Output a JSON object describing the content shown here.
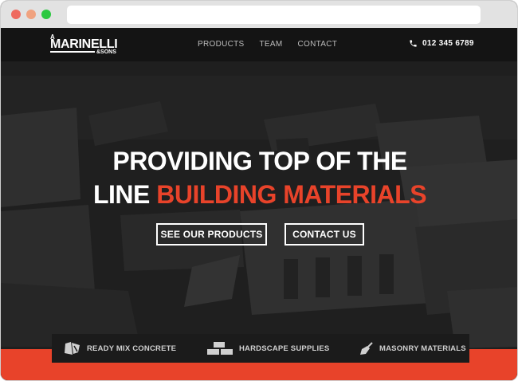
{
  "logo": {
    "prefix": "A",
    "name": "MARINELLI",
    "suffix": "&SONS"
  },
  "nav": {
    "items": [
      {
        "label": "PRODUCTS"
      },
      {
        "label": "TEAM"
      },
      {
        "label": "CONTACT"
      }
    ]
  },
  "phone": {
    "number": "012 345 6789",
    "icon": "phone-icon"
  },
  "hero": {
    "headline_line1": "PROVIDING TOP OF THE",
    "headline_line2_prefix": "LINE ",
    "headline_line2_accent": "BUILDING MATERIALS",
    "cta_products": "SEE OUR PRODUCTS",
    "cta_contact": "CONTACT US"
  },
  "features": [
    {
      "label": "READY MIX CONCRETE",
      "icon": "concrete-icon"
    },
    {
      "label": "HARDSCAPE SUPPLIES",
      "icon": "bricks-icon"
    },
    {
      "label": "MASONRY MATERIALS",
      "icon": "trowel-icon"
    }
  ],
  "colors": {
    "accent": "#e8432a",
    "nav_bg": "#141414",
    "hero_bg": "#262626"
  }
}
